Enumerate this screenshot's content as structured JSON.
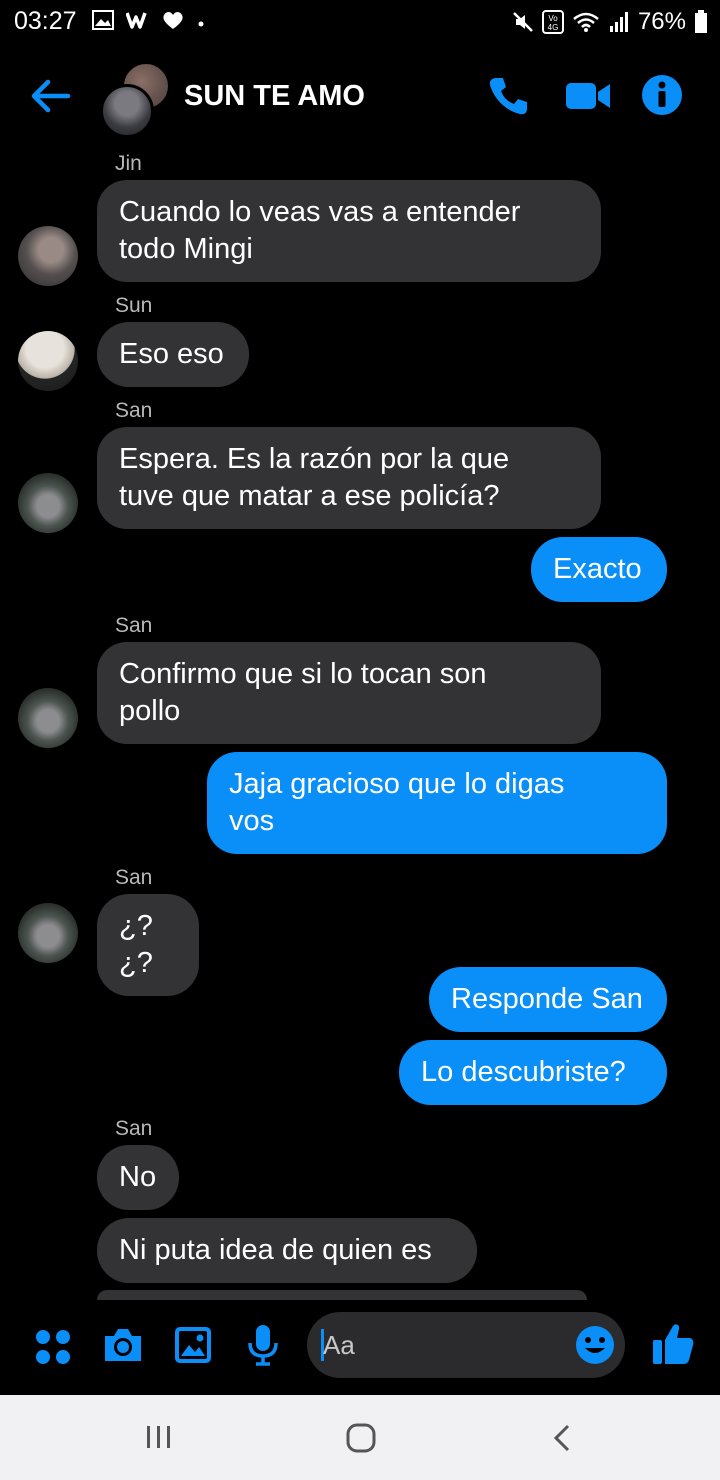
{
  "status": {
    "time": "03:27",
    "battery": "76%",
    "left_icons": [
      "image-icon",
      "w-icon",
      "heart-icon",
      "dot-icon"
    ],
    "right_icons": [
      "mute-icon",
      "volte-icon",
      "wifi-icon",
      "signal-icon",
      "battery-icon"
    ]
  },
  "header": {
    "title": "SUN TE AMO",
    "icons": [
      "back-arrow-icon",
      "phone-icon",
      "video-icon",
      "info-icon"
    ],
    "accent": "#0a8ef7"
  },
  "messages": [
    {
      "sender": "Jin",
      "text": "Cuando lo veas vas a entender\ntodo Mingi",
      "direction": "in"
    },
    {
      "sender": "Sun",
      "text": "Eso eso",
      "direction": "in"
    },
    {
      "sender": "San",
      "text": "Espera. Es la razón por la que\ntuve que matar a ese policía?",
      "direction": "in"
    },
    {
      "text": "Exacto",
      "direction": "out"
    },
    {
      "sender": "San",
      "text": "Confirmo que si lo tocan son\npollo",
      "direction": "in"
    },
    {
      "text": "Jaja gracioso que lo digas\nvos",
      "direction": "out"
    },
    {
      "sender": "San",
      "text": "¿?¿?",
      "direction": "in"
    },
    {
      "text": "Responde San",
      "direction": "out"
    },
    {
      "text": "Lo descubriste?",
      "direction": "out"
    },
    {
      "sender": "San",
      "text": "No",
      "direction": "in"
    },
    {
      "text": "Ni puta idea de quien es",
      "direction": "in"
    }
  ],
  "composer": {
    "placeholder": "Aa",
    "icons": [
      "apps-icon",
      "camera-icon",
      "gallery-icon",
      "mic-icon",
      "emoji-icon",
      "like-icon"
    ]
  },
  "colors": {
    "outgoing_bubble": "#0a8ef7",
    "incoming_bubble": "#333335",
    "background": "#000000"
  },
  "navbar": {
    "icons": [
      "recents-icon",
      "home-icon",
      "back-icon"
    ]
  }
}
